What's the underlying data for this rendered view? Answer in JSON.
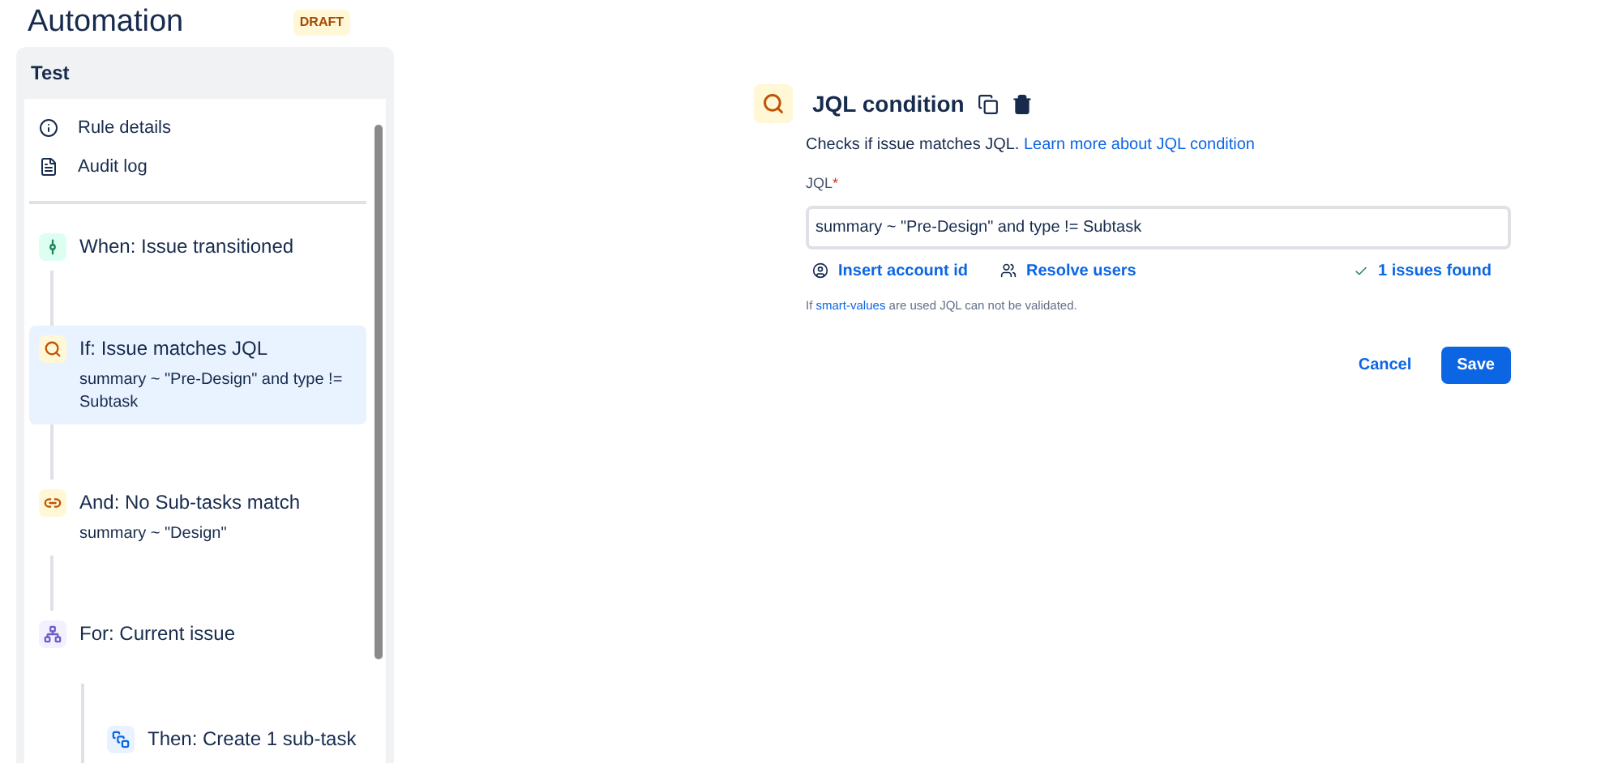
{
  "header": {
    "title": "Automation",
    "badge": "DRAFT"
  },
  "rule": {
    "name": "Test",
    "menu": [
      {
        "kind": "info",
        "label": "Rule details"
      },
      {
        "kind": "log",
        "label": "Audit log"
      }
    ],
    "steps": [
      {
        "kind": "trigger",
        "title": "When: Issue transitioned",
        "selected": false
      },
      {
        "kind": "condition",
        "title": "If: Issue matches JQL",
        "detail": "summary ~ \"Pre-Design\" and type != Subtask",
        "selected": true
      },
      {
        "kind": "related",
        "title": "And: No Sub-tasks match",
        "detail": "summary ~ \"Design\"",
        "selected": false
      },
      {
        "kind": "branch",
        "title": "For: Current issue",
        "selected": false,
        "children": [
          {
            "kind": "action",
            "title": "Then: Create 1 sub-task",
            "selected": false
          }
        ]
      }
    ]
  },
  "editor": {
    "title": "JQL condition",
    "description": "Checks if issue matches JQL.",
    "description_link": "Learn more about JQL condition",
    "field_label": "JQL",
    "required_mark": "*",
    "value": "summary ~ \"Pre-Design\" and type != Subtask",
    "actions": [
      {
        "kind": "account",
        "label": "Insert account id"
      },
      {
        "kind": "users",
        "label": "Resolve users"
      }
    ],
    "result": "1 issues found",
    "hint_before": "If",
    "hint_link": "smart-values",
    "hint_after": "are used JQL can not be validated.",
    "buttons": [
      {
        "kind": "subtle",
        "label": "Cancel"
      },
      {
        "kind": "primary",
        "label": "Save"
      }
    ]
  }
}
